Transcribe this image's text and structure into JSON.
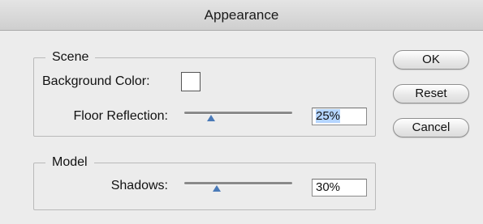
{
  "window": {
    "title": "Appearance"
  },
  "scene": {
    "title": "Scene",
    "background_color_label": "Background Color:",
    "background_color": "#ffffff",
    "floor_reflection_label": "Floor Reflection:",
    "floor_reflection_value": "25%",
    "floor_reflection_fraction": 0.25
  },
  "model": {
    "title": "Model",
    "shadows_label": "Shadows:",
    "shadows_value": "30%",
    "shadows_fraction": 0.3
  },
  "buttons": {
    "ok": "OK",
    "reset": "Reset",
    "cancel": "Cancel"
  },
  "colors": {
    "selection": "#b5d5ff",
    "slider_thumb": "#4a7ab8"
  }
}
